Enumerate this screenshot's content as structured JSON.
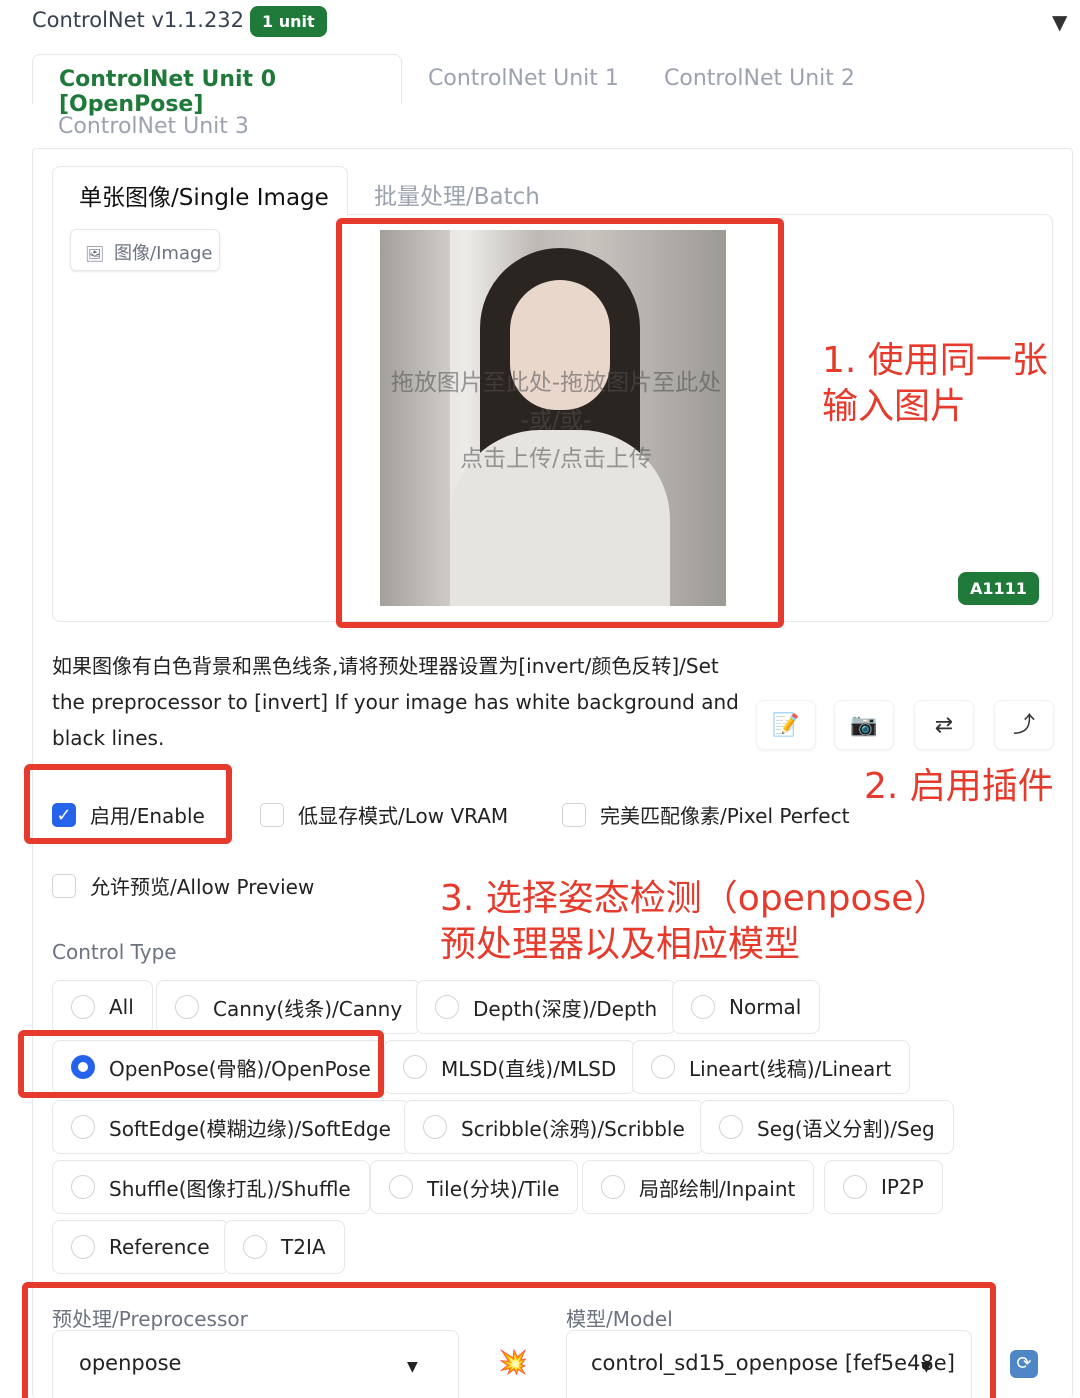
{
  "header": {
    "title": "ControlNet v1.1.232",
    "unit_badge": "1 unit",
    "collapse_icon": "▼"
  },
  "unit_tabs": [
    {
      "label": "ControlNet Unit 0 [OpenPose]",
      "active": true
    },
    {
      "label": "ControlNet Unit 1",
      "active": false
    },
    {
      "label": "ControlNet Unit 2",
      "active": false
    },
    {
      "label": "ControlNet Unit 3",
      "active": false
    }
  ],
  "image_tabs": [
    {
      "label": "单张图像/Single Image",
      "active": true
    },
    {
      "label": "批量处理/Batch",
      "active": false
    }
  ],
  "image_input": {
    "label": "图像/Image",
    "label_icon": "image-icon",
    "drop_hint": [
      "拖放图片至此处-拖放图片至此处",
      "-或/或-",
      "点击上传/点击上传"
    ],
    "badge": "A1111"
  },
  "annotations": {
    "note1": [
      "1. 使用同一张",
      "输入图片"
    ],
    "note2": "2. 启用插件",
    "note3": [
      "3. 选择姿态检测（openpose）",
      "预处理器以及相应模型"
    ],
    "accent": "#e53a2c"
  },
  "hint_text": "如果图像有白色背景和黑色线条,请将预处理器设置为[invert/颜色反转]/Set the preprocessor to [invert] If your image has white background and black lines.",
  "tool_buttons": [
    {
      "name": "edit-icon",
      "glyph": "📝"
    },
    {
      "name": "camera-icon",
      "glyph": "📷"
    },
    {
      "name": "swap-icon",
      "glyph": "⇄"
    },
    {
      "name": "send-up-icon",
      "glyph": "⤴"
    }
  ],
  "checkboxes": {
    "enable": {
      "label": "启用/Enable",
      "checked": true
    },
    "low_vram": {
      "label": "低显存模式/Low VRAM",
      "checked": false
    },
    "pixel_perfect": {
      "label": "完美匹配像素/Pixel Perfect",
      "checked": false
    },
    "allow_preview": {
      "label": "允许预览/Allow Preview",
      "checked": false
    }
  },
  "control_type": {
    "label": "Control Type",
    "selected": "OpenPose(骨骼)/OpenPose",
    "options": [
      "All",
      "Canny(线条)/Canny",
      "Depth(深度)/Depth",
      "Normal",
      "OpenPose(骨骼)/OpenPose",
      "MLSD(直线)/MLSD",
      "Lineart(线稿)/Lineart",
      "SoftEdge(模糊边缘)/SoftEdge",
      "Scribble(涂鸦)/Scribble",
      "Seg(语义分割)/Seg",
      "Shuffle(图像打乱)/Shuffle",
      "Tile(分块)/Tile",
      "局部绘制/Inpaint",
      "IP2P",
      "Reference",
      "T2IA"
    ]
  },
  "preprocessor": {
    "label": "预处理/Preprocessor",
    "value": "openpose"
  },
  "model": {
    "label": "模型/Model",
    "value": "control_sd15_openpose [fef5e48e]"
  },
  "colors": {
    "brand_green": "#1f7a3a",
    "accent_blue": "#2563eb",
    "annotation_red": "#e53a2c"
  }
}
